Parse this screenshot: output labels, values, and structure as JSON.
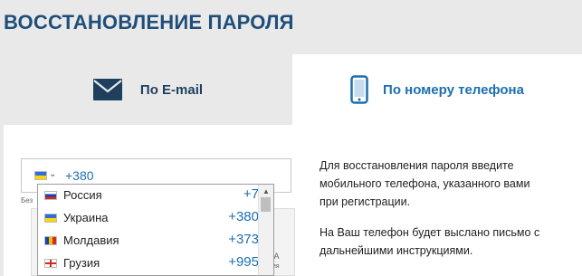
{
  "page": {
    "title": "ВОССТАНОВЛЕНИЕ ПАРОЛЯ"
  },
  "tabs": [
    {
      "label": "По E-mail",
      "icon": "envelope-icon",
      "active": false
    },
    {
      "label": "По номеру телефона",
      "icon": "smartphone-icon",
      "active": true
    }
  ],
  "phone_input": {
    "value": "+380",
    "selected_flag": "ua"
  },
  "truncated_label": "Без",
  "dropdown": {
    "items": [
      {
        "name": "Россия",
        "code": "+7",
        "flag": "ru"
      },
      {
        "name": "Украина",
        "code": "+380",
        "flag": "ua"
      },
      {
        "name": "Молдавия",
        "code": "+373",
        "flag": "md"
      },
      {
        "name": "Грузия",
        "code": "+995",
        "flag": "ge"
      }
    ]
  },
  "bg_fragments": {
    "line1": "НА",
    "line2": "мия"
  },
  "info": {
    "line1": "Для восстановления пароля введите",
    "line2": "мобильного телефона, указанного вами",
    "line3": "при регистрации.",
    "line4": "На Ваш телефон будет выслано письмо с",
    "line5": "дальнейшими инструкциями."
  },
  "colors": {
    "title": "#1f4e79",
    "accent": "#1d6fb0",
    "tab_inactive_bg": "#e9e9e9",
    "tab_active_bg": "#ffffff"
  }
}
